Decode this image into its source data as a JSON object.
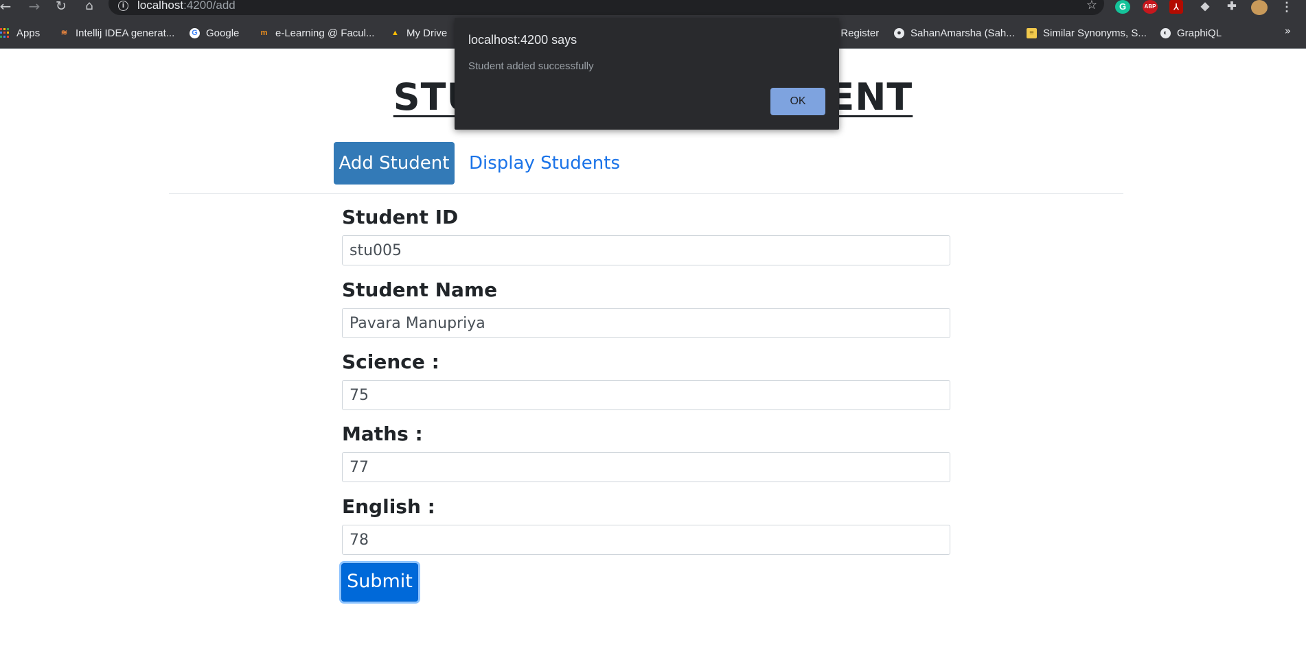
{
  "browser": {
    "url_host": "localhost",
    "url_path": ":4200/add",
    "bookmarks": [
      {
        "label": "Apps"
      },
      {
        "label": "Intellij IDEA generat..."
      },
      {
        "label": "Google"
      },
      {
        "label": "e-Learning @ Facul..."
      },
      {
        "label": "My Drive"
      },
      {
        "label": "t Register"
      },
      {
        "label": "SahanAmarsha (Sah..."
      },
      {
        "label": "Similar Synonyms, S..."
      },
      {
        "label": "GraphiQL"
      }
    ],
    "more_bookmarks": "»",
    "extensions": {
      "grammarly": "G",
      "abp": "ABP"
    }
  },
  "dialog": {
    "title": "localhost:4200 says",
    "message": "Student added successfully",
    "ok_label": "OK"
  },
  "page": {
    "title": "STUDENT MANAGEMENT",
    "tabs": {
      "add": "Add Student",
      "display": "Display Students"
    },
    "form": {
      "student_id_label": "Student ID",
      "student_id_value": "stu005",
      "student_name_label": "Student Name",
      "student_name_value": "Pavara Manupriya",
      "science_label": "Science :",
      "science_value": "75",
      "maths_label": "Maths :",
      "maths_value": "77",
      "english_label": "English :",
      "english_value": "78",
      "submit_label": "Submit"
    }
  },
  "colors": {
    "chrome_bg": "#35363a",
    "omnibox_bg": "#202124",
    "active_tab": "#337ab7",
    "link": "#1a73e8",
    "submit": "#0069d9",
    "dialog_bg": "#292a2d",
    "dialog_ok": "#8ab4f8"
  }
}
